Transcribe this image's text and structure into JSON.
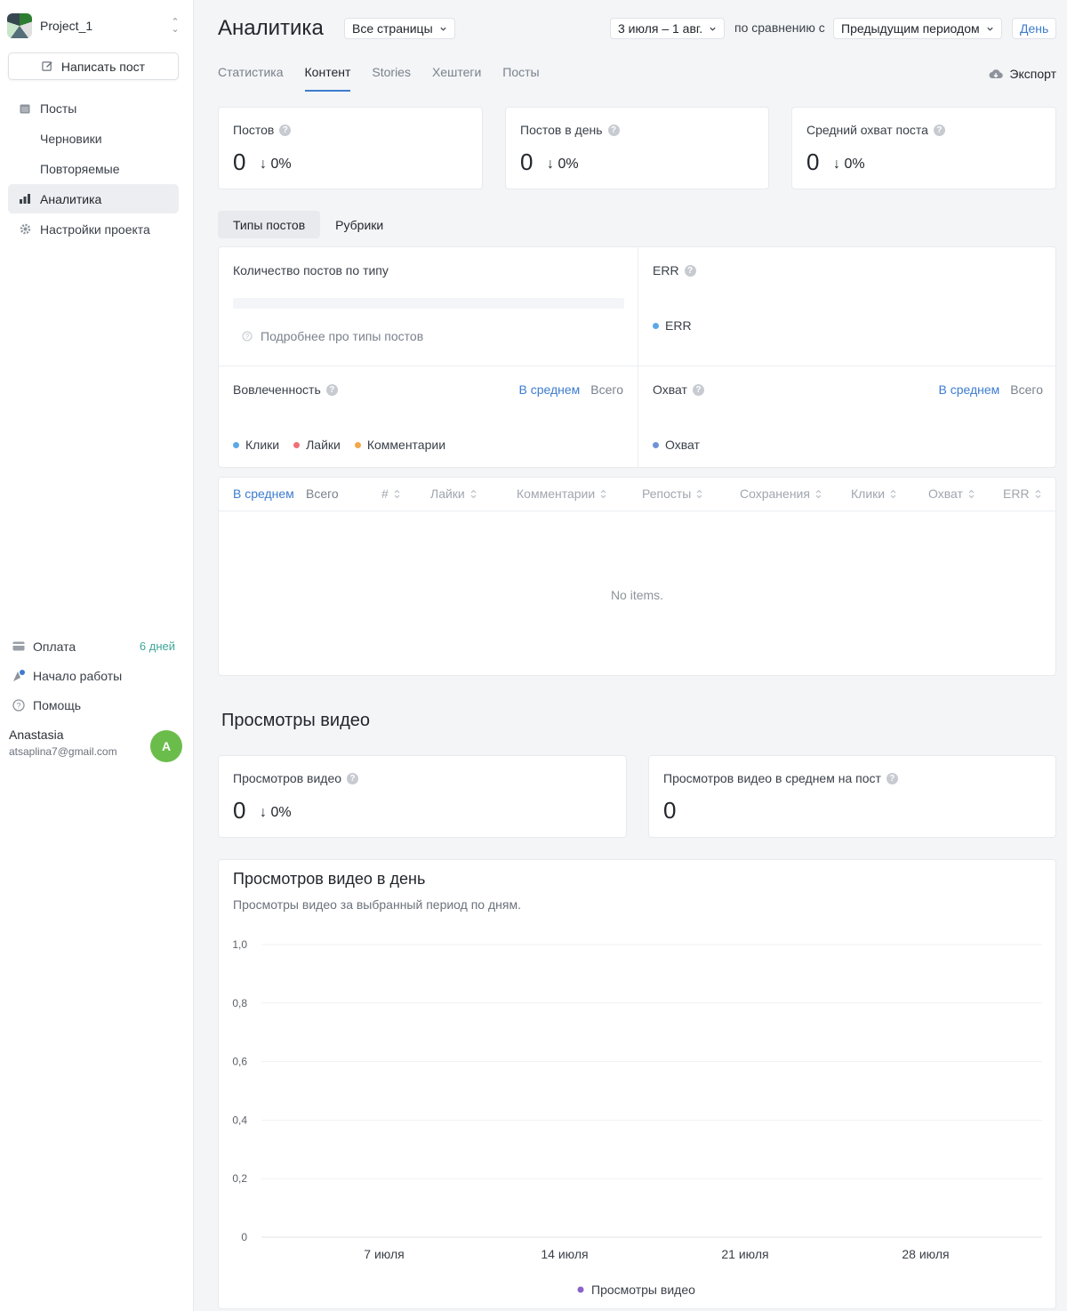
{
  "sidebar": {
    "project_name": "Project_1",
    "write_post": "Написать пост",
    "nav": [
      {
        "label": "Посты",
        "icon": "calendar-icon",
        "sub": false,
        "active": false
      },
      {
        "label": "Черновики",
        "sub": true,
        "active": false
      },
      {
        "label": "Повторяемые",
        "sub": true,
        "active": false
      },
      {
        "label": "Аналитика",
        "icon": "bar-chart-icon",
        "sub": false,
        "active": true
      },
      {
        "label": "Настройки проекта",
        "icon": "gear-icon",
        "sub": false,
        "active": false
      }
    ],
    "payment": "Оплата",
    "trial": "6 дней",
    "getting_started": "Начало работы",
    "help": "Помощь",
    "user_name": "Anastasia",
    "user_email": "atsaplina7@gmail.com",
    "user_initial": "A"
  },
  "header": {
    "title": "Аналитика",
    "pages_select": "Все страницы",
    "date_range": "3 июля – 1 авг.",
    "compare_text": "по сравнению с",
    "compare_select": "Предыдущим периодом",
    "granularity": "День"
  },
  "tabs": [
    "Статистика",
    "Контент",
    "Stories",
    "Хештеги",
    "Посты"
  ],
  "active_tab": 1,
  "export": "Экспорт",
  "kpis": [
    {
      "label": "Постов",
      "value": "0",
      "delta": "↓ 0%"
    },
    {
      "label": "Постов в день",
      "value": "0",
      "delta": "↓ 0%"
    },
    {
      "label": "Средний охват поста",
      "value": "0",
      "delta": "↓ 0%"
    }
  ],
  "segments": [
    "Типы постов",
    "Рубрики"
  ],
  "panels": {
    "post_types_title": "Количество постов по типу",
    "post_types_more": "Подробнее про типы постов",
    "err_title": "ERR",
    "err_legend": "ERR",
    "engagement_title": "Вовлеченность",
    "engagement_legend": [
      "Клики",
      "Лайки",
      "Комментарии"
    ],
    "reach_title": "Охват",
    "reach_legend": "Охват",
    "avg": "В среднем",
    "total": "Всего"
  },
  "table": {
    "avg": "В среднем",
    "total": "Всего",
    "columns": [
      "#",
      "Лайки",
      "Комментарии",
      "Репосты",
      "Сохранения",
      "Клики",
      "Охват",
      "ERR"
    ],
    "empty": "No items."
  },
  "video": {
    "section_title": "Просмотры видео",
    "kpis": [
      {
        "label": "Просмотров видео",
        "value": "0",
        "delta": "↓ 0%"
      },
      {
        "label": "Просмотров видео в среднем на пост",
        "value": "0"
      }
    ],
    "chart_title": "Просмотров видео в день",
    "chart_subtitle": "Просмотры видео за выбранный период по дням."
  },
  "colors": {
    "accent": "#3d7ccf",
    "clicks": "#5aa9e6",
    "likes": "#ef7177",
    "comments": "#f2a74b",
    "reach": "#6f93d9",
    "video": "#8a63c9",
    "trial": "#3fa79a"
  },
  "chart_data": {
    "type": "line",
    "title": "Просмотров видео в день",
    "subtitle": "Просмотры видео за выбранный период по дням.",
    "y_ticks": [
      "1,0",
      "0,8",
      "0,6",
      "0,4",
      "0,2",
      "0"
    ],
    "y_tick_values": [
      1.0,
      0.8,
      0.6,
      0.4,
      0.2,
      0
    ],
    "ylim": [
      0,
      1.0
    ],
    "x_ticks": [
      "7 июля",
      "14 июля",
      "21 июля",
      "28 июля"
    ],
    "grid": true,
    "legend_position": "bottom",
    "series": [
      {
        "name": "Просмотры видео",
        "values": []
      }
    ]
  }
}
